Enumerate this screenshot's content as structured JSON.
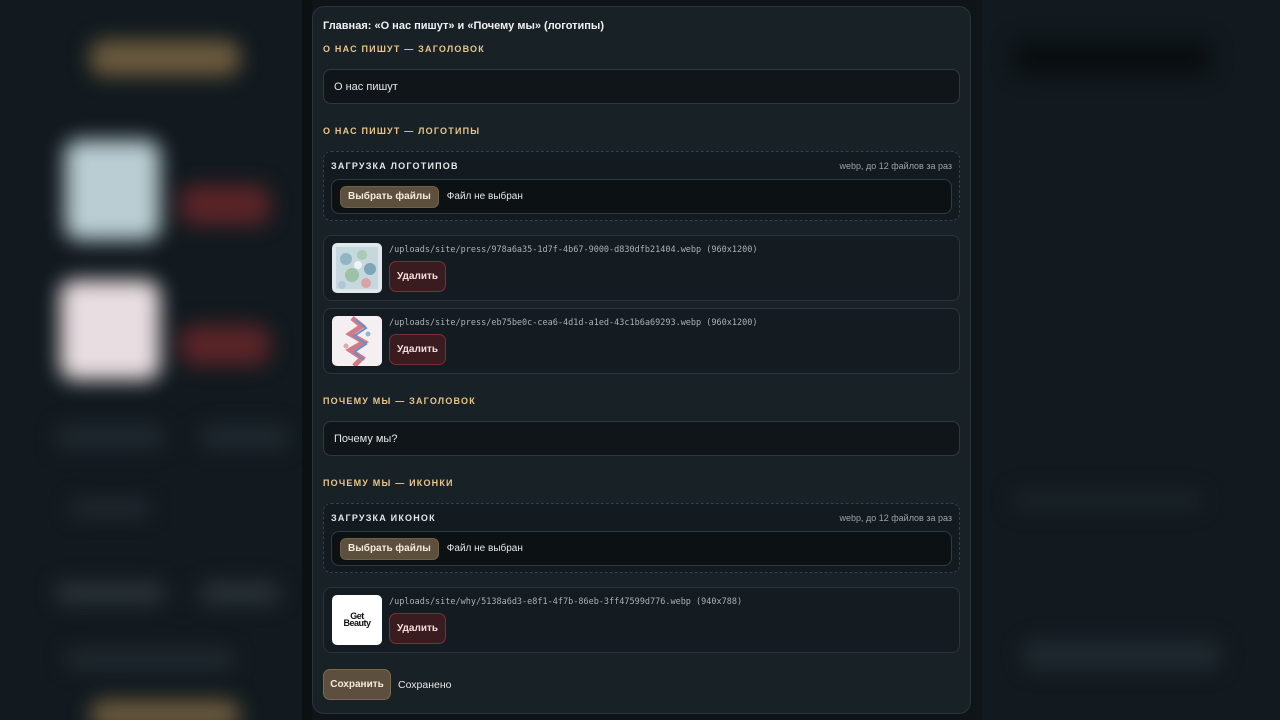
{
  "panel": {
    "title": "Главная: «О нас пишут» и «Почему мы» (логотипы)"
  },
  "press": {
    "heading_label": "О НАС ПИШУТ — ЗАГОЛОВОК",
    "heading_value": "О нас пишут",
    "logos_label": "О НАС ПИШУТ — ЛОГОТИПЫ",
    "upload": {
      "title": "ЗАГРУЗКА ЛОГОТИПОВ",
      "hint": "webp, до 12 файлов за раз",
      "button": "Выбрать файлы",
      "status": "Файл не выбран"
    },
    "items": [
      {
        "path": "/uploads/site/press/978a6a35-1d7f-4b67-9000-d830dfb21404.webp (960x1200)",
        "delete": "Удалить"
      },
      {
        "path": "/uploads/site/press/eb75be0c-cea6-4d1d-a1ed-43c1b6a69293.webp (960x1200)",
        "delete": "Удалить"
      }
    ]
  },
  "why": {
    "heading_label": "ПОЧЕМУ МЫ — ЗАГОЛОВОК",
    "heading_value": "Почему мы?",
    "icons_label": "ПОЧЕМУ МЫ — ИКОНКИ",
    "upload": {
      "title": "ЗАГРУЗКА ИКОНОК",
      "hint": "webp, до 12 файлов за раз",
      "button": "Выбрать файлы",
      "status": "Файл не выбран"
    },
    "items": [
      {
        "path": "/uploads/site/why/5138a6d3-e8f1-4f7b-86eb-3ff47599d776.webp (940x788)",
        "delete": "Удалить",
        "logo_text": "Get Beauty"
      }
    ]
  },
  "footer": {
    "save": "Сохранить",
    "status": "Сохранено"
  },
  "colors": {
    "accent": "#e8c58a",
    "button_brown": "#5c4f3d",
    "danger": "#7a2f33"
  }
}
